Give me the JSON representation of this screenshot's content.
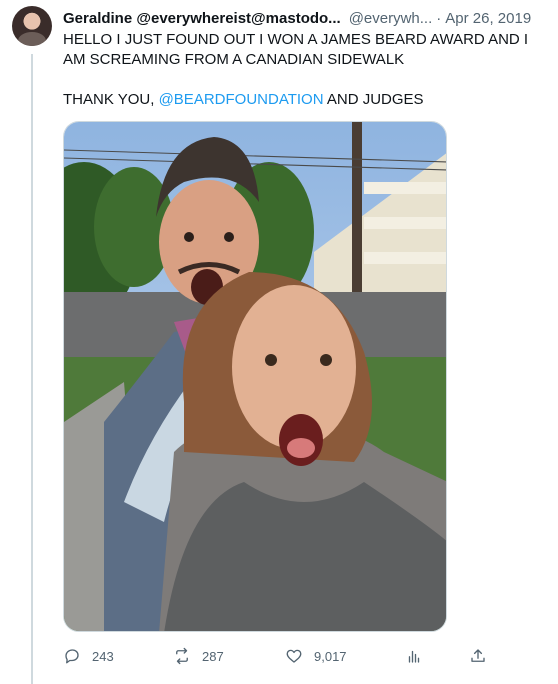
{
  "tweet": {
    "author_name": "Geraldine @everywhereist@mastodo...",
    "handle": "@everywh...",
    "separator": "·",
    "date": "Apr 26, 2019",
    "line1": "HELLO I JUST FOUND OUT I WON A JAMES BEARD AWARD AND I AM SCREAMING FROM A CANADIAN SIDEWALK",
    "line2_prefix": "THANK YOU, ",
    "mention": "@BEARDFOUNDATION",
    "line2_suffix": " AND JUDGES"
  },
  "actions": {
    "replies": "243",
    "reposts": "287",
    "likes": "9,017"
  },
  "icons": {
    "reply": "reply-icon",
    "repost": "repost-icon",
    "like": "heart-icon",
    "views": "analytics-icon",
    "share": "share-icon"
  },
  "colors": {
    "text": "#0f1419",
    "secondary": "#536471",
    "link": "#1d9bf0",
    "border": "#cfd9de"
  }
}
